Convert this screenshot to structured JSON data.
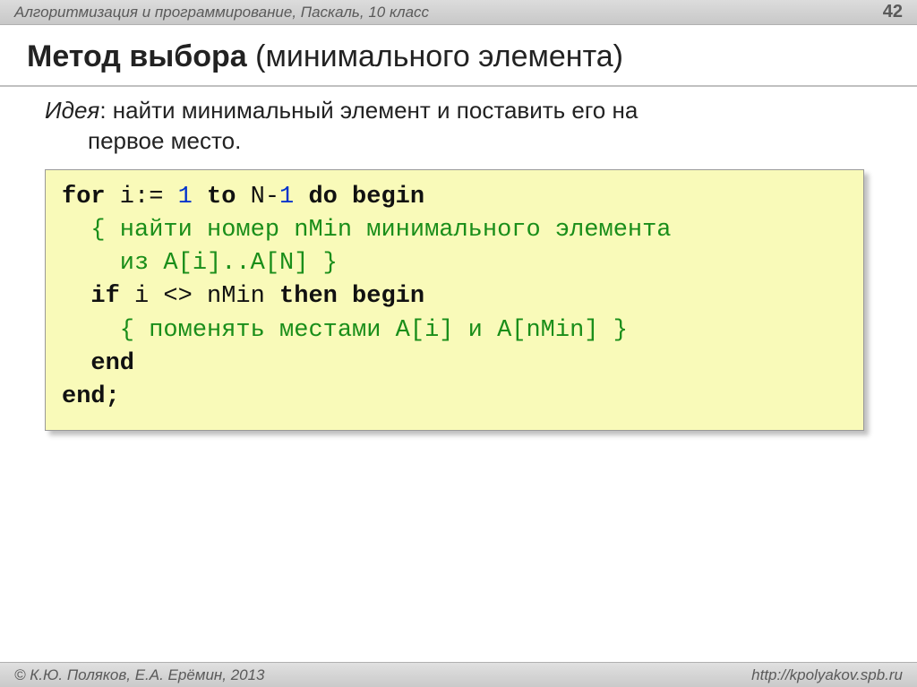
{
  "header": {
    "course": "Алгоритмизация и программирование, Паскаль, 10 класс",
    "page": "42"
  },
  "title": {
    "bold": "Метод выбора",
    "rest": " (минимального элемента)"
  },
  "idea": {
    "label": "Идея",
    "line1": ": найти минимальный элемент и поставить его на",
    "line2": "первое место."
  },
  "code": {
    "l1_for": "for",
    "l1_ivar": " i:= ",
    "l1_one": "1",
    "l1_to": " to",
    "l1_nminus": " N-",
    "l1_one2": "1",
    "l1_do": " do begin",
    "l2_cmt": "  { найти номер nMin минимального элемента",
    "l3_cmt": "    из A[i]..A[N] }",
    "l4_if": "  if",
    "l4_mid": " i <> nMin ",
    "l4_then": "then begin",
    "l5_cmt": "    { поменять местами A[i] и A[nMin] }",
    "l6_end": "  end",
    "l7_end": "end;"
  },
  "footer": {
    "left": "© К.Ю. Поляков, Е.А. Ерёмин, 2013",
    "right": "http://kpolyakov.spb.ru"
  }
}
